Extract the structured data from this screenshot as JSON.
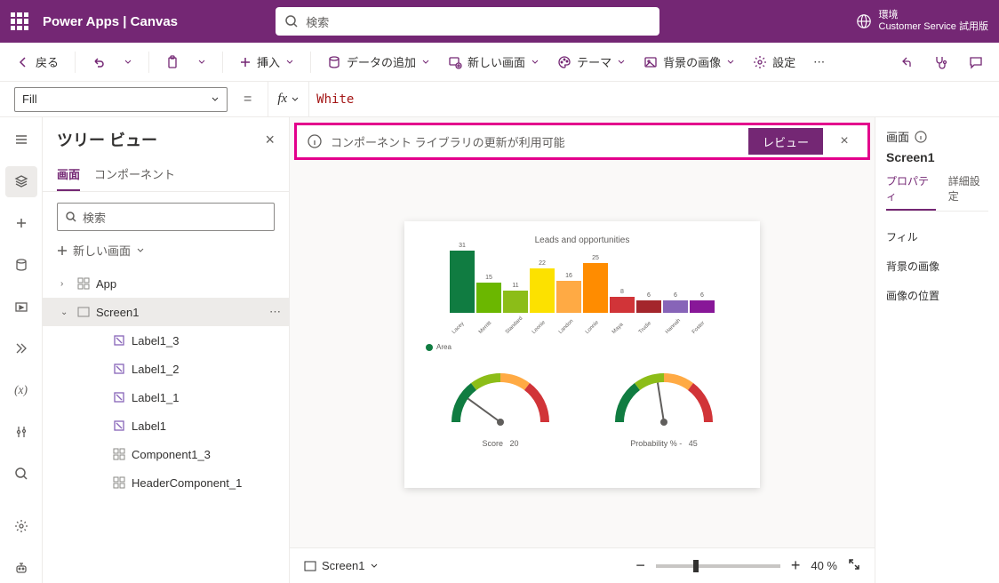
{
  "header": {
    "brand": "Power Apps  |  Canvas",
    "search_ph": "検索",
    "env_label": "環境",
    "env_name": "Customer Service 試用版"
  },
  "cmd": {
    "back": "戻る",
    "insert": "挿入",
    "data": "データの追加",
    "newscreen": "新しい画面",
    "theme": "テーマ",
    "bg": "背景の画像",
    "settings": "設定"
  },
  "formula": {
    "prop": "Fill",
    "value": "White"
  },
  "notif": {
    "msg": "コンポーネント ライブラリの更新が利用可能",
    "review": "レビュー"
  },
  "tree": {
    "title": "ツリー ビュー",
    "tab_screens": "画面",
    "tab_components": "コンポーネント",
    "search_ph": "検索",
    "newscreen": "新しい画面",
    "app": "App",
    "screen1": "Screen1",
    "nodes": [
      "Label1_3",
      "Label1_2",
      "Label1_1",
      "Label1",
      "Component1_3",
      "HeaderComponent_1"
    ]
  },
  "right": {
    "title": "画面",
    "name": "Screen1",
    "tab_prop": "プロパティ",
    "tab_adv": "詳細設定",
    "rows": [
      "フィル",
      "背景の画像",
      "画像の位置"
    ]
  },
  "status": {
    "screen": "Screen1",
    "zoom": "40  %"
  },
  "chart_data": {
    "type": "bar",
    "title": "Leads and opportunities",
    "categories": [
      "Lacey",
      "Merritt",
      "Standard",
      "Leonie",
      "Landon",
      "Lonnie",
      "Maya",
      "Trudie",
      "Hannah",
      "Foster"
    ],
    "values": [
      31,
      15,
      11,
      22,
      16,
      25,
      8,
      6,
      6,
      6
    ],
    "colors": [
      "#107c41",
      "#6bb700",
      "#8cbd18",
      "#fce100",
      "#ffaa44",
      "#ff8c00",
      "#d13438",
      "#a4262c",
      "#8764b8",
      "#881798"
    ],
    "legend": "Area",
    "gauges": [
      {
        "label": "Score",
        "value": 20
      },
      {
        "label": "Probability % -",
        "value": 45
      }
    ]
  }
}
